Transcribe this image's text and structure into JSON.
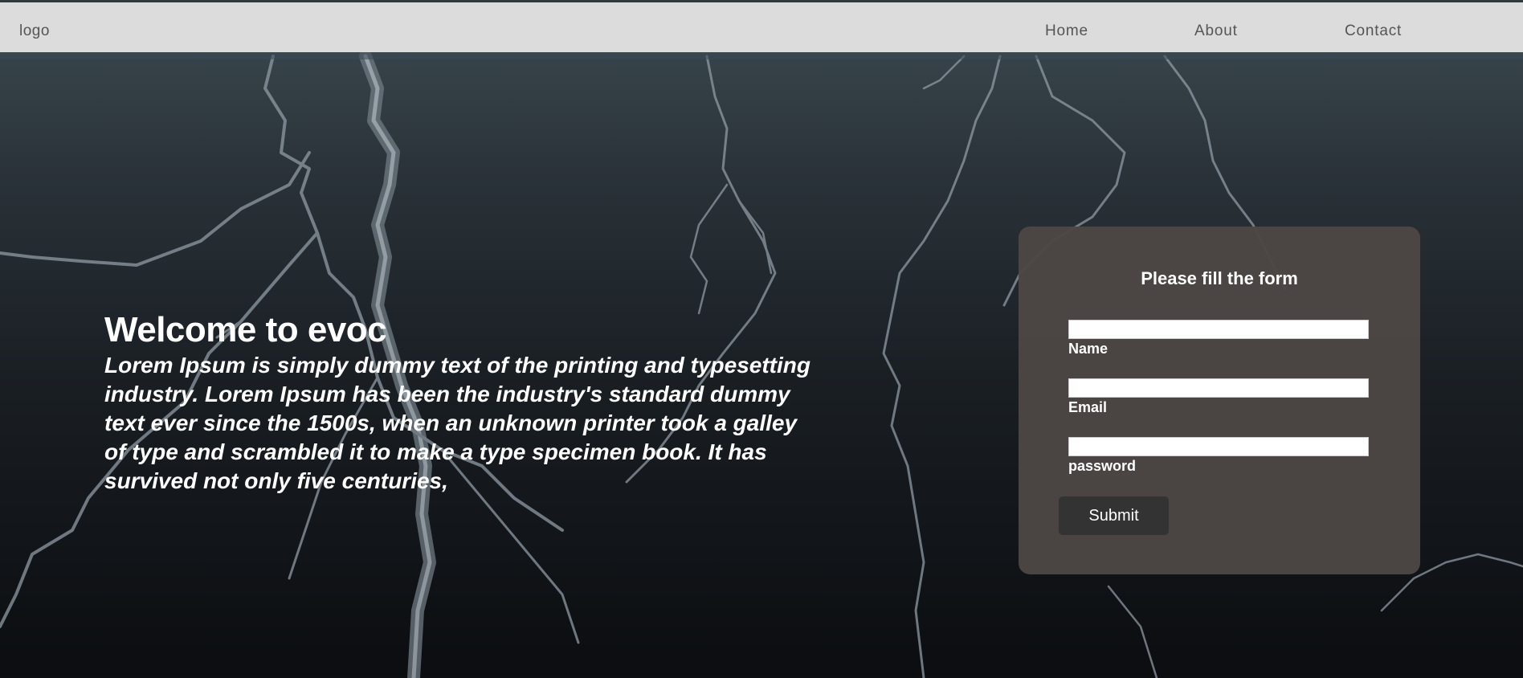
{
  "nav": {
    "logo": "logo",
    "links": [
      {
        "label": "Home"
      },
      {
        "label": "About"
      },
      {
        "label": "Contact"
      }
    ]
  },
  "hero": {
    "title": "Welcome to evoc",
    "text": "Lorem Ipsum is simply dummy text of the printing and typesetting industry. Lorem Ipsum has been the industry's standard dummy text ever since the 1500s, when an unknown printer took a galley of type and scrambled it to make a type specimen book. It has survived not only five centuries,"
  },
  "form": {
    "title": "Please fill the form",
    "fields": [
      {
        "label": "Name",
        "value": ""
      },
      {
        "label": "Email",
        "value": ""
      },
      {
        "label": "password",
        "value": ""
      }
    ],
    "submit_label": "Submit"
  },
  "colors": {
    "navbar_bg": "#dcdcdc",
    "form_bg": "#4c4644",
    "button_bg": "#333333",
    "text": "#ffffff"
  }
}
